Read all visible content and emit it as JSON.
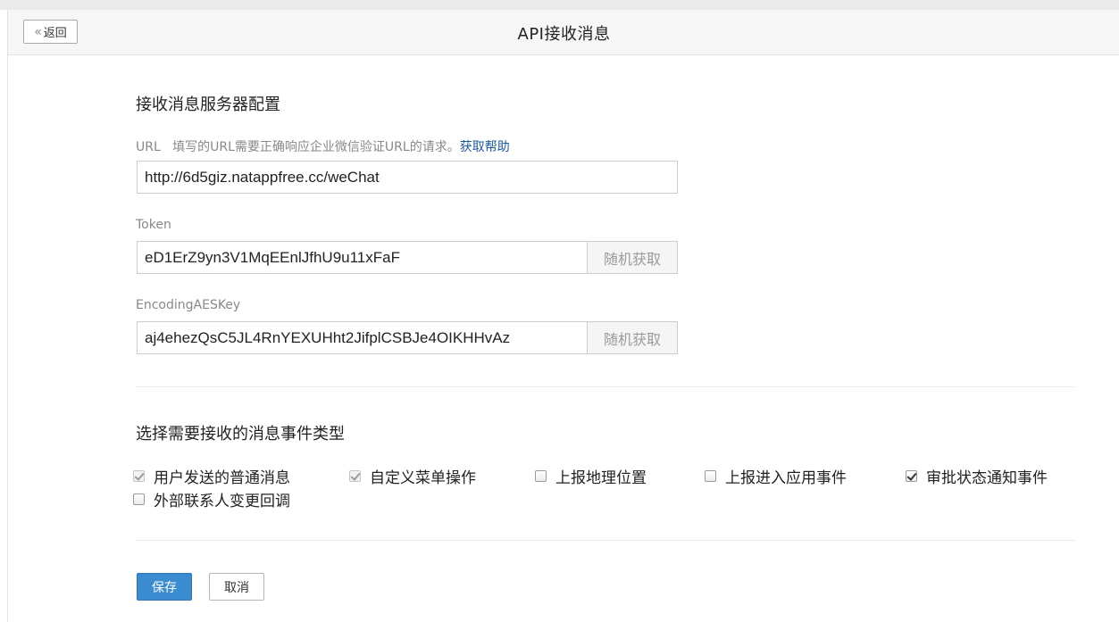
{
  "header": {
    "back_label": "返回",
    "title": "API接收消息"
  },
  "server_config": {
    "section_title": "接收消息服务器配置",
    "url": {
      "label": "URL",
      "hint": "填写的URL需要正确响应企业微信验证URL的请求。",
      "help_link": "获取帮助",
      "value": "http://6d5giz.natappfree.cc/weChat"
    },
    "token": {
      "label": "Token",
      "value": "eD1ErZ9yn3V1MqEEnlJfhU9u11xFaF",
      "random_button": "随机获取"
    },
    "aes_key": {
      "label": "EncodingAESKey",
      "value": "aj4ehezQsC5JL4RnYEXUHht2JifplCSBJe4OIKHHvAz",
      "random_button": "随机获取"
    }
  },
  "events": {
    "section_title": "选择需要接收的消息事件类型",
    "items": [
      {
        "label": "用户发送的普通消息",
        "state": "checked-disabled"
      },
      {
        "label": "自定义菜单操作",
        "state": "checked-disabled"
      },
      {
        "label": "上报地理位置",
        "state": "unchecked"
      },
      {
        "label": "上报进入应用事件",
        "state": "unchecked"
      },
      {
        "label": "审批状态通知事件",
        "state": "checked"
      },
      {
        "label": "外部联系人变更回调",
        "state": "unchecked"
      }
    ]
  },
  "actions": {
    "save_label": "保存",
    "cancel_label": "取消"
  },
  "colors": {
    "primary_button": "#3a8bd0",
    "link": "#1c5aa6"
  }
}
